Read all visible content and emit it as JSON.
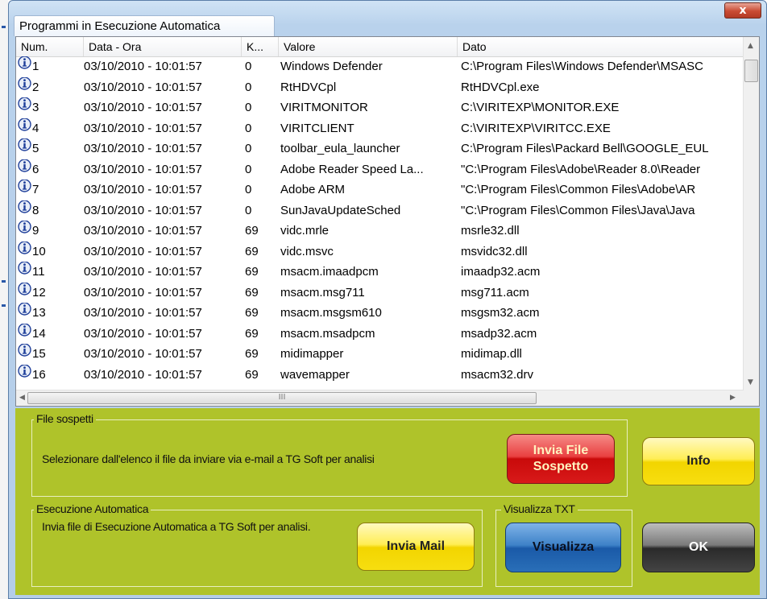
{
  "window": {
    "title": "Programmi in Esecuzione Automatica",
    "close_label": "x"
  },
  "columns": [
    "Num.",
    "Data - Ora",
    "K...",
    "Valore",
    "Dato"
  ],
  "rows": [
    {
      "num": "1",
      "date": "03/10/2010 - 10:01:57",
      "k": "0",
      "valore": "Windows Defender",
      "dato": "C:\\Program Files\\Windows Defender\\MSASC"
    },
    {
      "num": "2",
      "date": "03/10/2010 - 10:01:57",
      "k": "0",
      "valore": "RtHDVCpl",
      "dato": "RtHDVCpl.exe"
    },
    {
      "num": "3",
      "date": "03/10/2010 - 10:01:57",
      "k": "0",
      "valore": "VIRITMONITOR",
      "dato": "C:\\VIRITEXP\\MONITOR.EXE"
    },
    {
      "num": "4",
      "date": "03/10/2010 - 10:01:57",
      "k": "0",
      "valore": "VIRITCLIENT",
      "dato": "C:\\VIRITEXP\\VIRITCC.EXE"
    },
    {
      "num": "5",
      "date": "03/10/2010 - 10:01:57",
      "k": "0",
      "valore": "toolbar_eula_launcher",
      "dato": "C:\\Program Files\\Packard Bell\\GOOGLE_EUL"
    },
    {
      "num": "6",
      "date": "03/10/2010 - 10:01:57",
      "k": "0",
      "valore": "Adobe Reader Speed La...",
      "dato": "\"C:\\Program Files\\Adobe\\Reader 8.0\\Reader"
    },
    {
      "num": "7",
      "date": "03/10/2010 - 10:01:57",
      "k": "0",
      "valore": "Adobe ARM",
      "dato": "\"C:\\Program Files\\Common Files\\Adobe\\AR"
    },
    {
      "num": "8",
      "date": "03/10/2010 - 10:01:57",
      "k": "0",
      "valore": "SunJavaUpdateSched",
      "dato": "\"C:\\Program Files\\Common Files\\Java\\Java"
    },
    {
      "num": "9",
      "date": "03/10/2010 - 10:01:57",
      "k": "69",
      "valore": "vidc.mrle",
      "dato": "msrle32.dll"
    },
    {
      "num": "10",
      "date": "03/10/2010 - 10:01:57",
      "k": "69",
      "valore": "vidc.msvc",
      "dato": "msvidc32.dll"
    },
    {
      "num": "11",
      "date": "03/10/2010 - 10:01:57",
      "k": "69",
      "valore": "msacm.imaadpcm",
      "dato": "imaadp32.acm"
    },
    {
      "num": "12",
      "date": "03/10/2010 - 10:01:57",
      "k": "69",
      "valore": "msacm.msg711",
      "dato": "msg711.acm"
    },
    {
      "num": "13",
      "date": "03/10/2010 - 10:01:57",
      "k": "69",
      "valore": "msacm.msgsm610",
      "dato": "msgsm32.acm"
    },
    {
      "num": "14",
      "date": "03/10/2010 - 10:01:57",
      "k": "69",
      "valore": "msacm.msadpcm",
      "dato": "msadp32.acm"
    },
    {
      "num": "15",
      "date": "03/10/2010 - 10:01:57",
      "k": "69",
      "valore": "midimapper",
      "dato": "midimap.dll"
    },
    {
      "num": "16",
      "date": "03/10/2010 - 10:01:57",
      "k": "69",
      "valore": "wavemapper",
      "dato": "msacm32.drv"
    }
  ],
  "scrollbar": {
    "h_grip": "III"
  },
  "file_sospetti": {
    "label": "File sospetti",
    "description": "Selezionare dall'elenco il file da inviare via e-mail a TG Soft per analisi",
    "send_button": "Invia File Sospetto",
    "info_button": "Info"
  },
  "esecuzione": {
    "label": "Esecuzione Automatica",
    "description": "Invia file di Esecuzione Automatica a TG Soft per analisi.",
    "mail_button": "Invia Mail"
  },
  "visualizza": {
    "label": "Visualizza TXT",
    "button": "Visualizza"
  },
  "ok_button": "OK",
  "colors": {
    "panel_green": "#afc32a",
    "button_red": "#d81a1a",
    "button_yellow": "#f2d500",
    "button_blue": "#1a5aa8",
    "button_black": "#2a2a2a",
    "info_icon_blue": "#1f3f9a"
  }
}
